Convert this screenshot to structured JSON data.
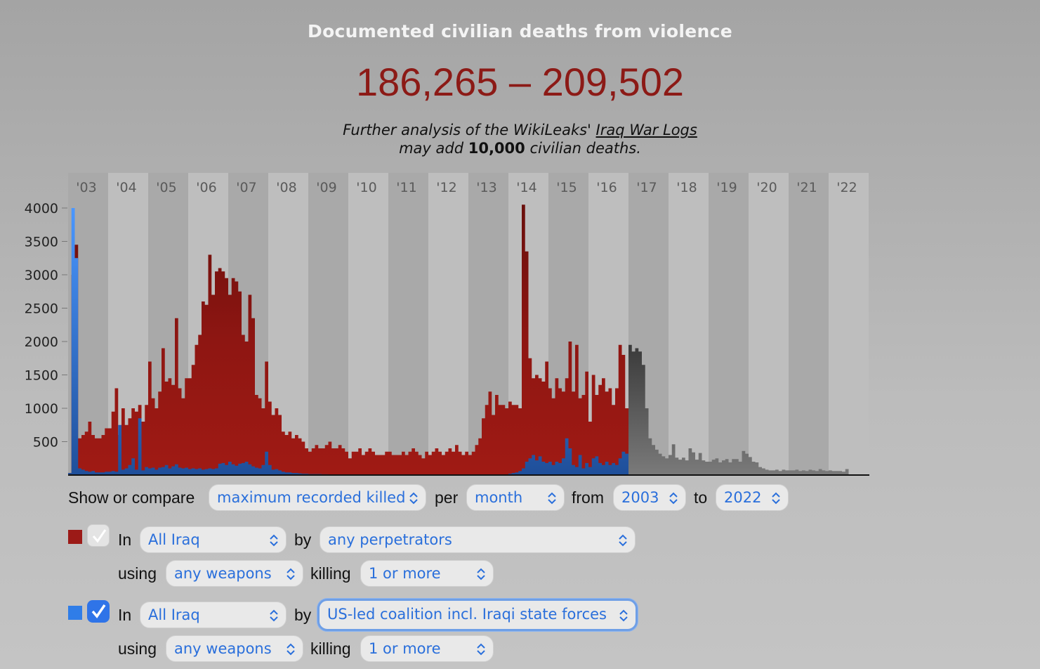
{
  "header": {
    "title": "Documented civilian deaths from violence",
    "range": "186,265 – 209,502",
    "note_line1_prefix": "Further analysis of the WikiLeaks' ",
    "note_link": "Iraq War Logs",
    "note_line2_prefix": "may add ",
    "note_bold": "10,000",
    "note_line2_suffix": " civilian deaths."
  },
  "chart_data": {
    "type": "bar",
    "x_ticks": [
      "'03",
      "'04",
      "'05",
      "'06",
      "'07",
      "'08",
      "'09",
      "'10",
      "'11",
      "'12",
      "'13",
      "'14",
      "'15",
      "'16",
      "'17",
      "'18",
      "'19",
      "'20",
      "'21",
      "'22"
    ],
    "y_ticks": [
      "4000",
      "3500",
      "3000",
      "2500",
      "2000",
      "1500",
      "1000",
      "500"
    ],
    "ylim": [
      0,
      4000
    ],
    "grid": "alternating year bands",
    "series": [
      {
        "color": "#8e1612",
        "start": "2003-01",
        "end": "2016-12",
        "monthly_values": [
          30,
          3000,
          3450,
          550,
          600,
          650,
          800,
          600,
          550,
          550,
          600,
          700,
          700,
          950,
          1300,
          600,
          1000,
          750,
          850,
          1000,
          950,
          1050,
          800,
          1050,
          1700,
          1150,
          1000,
          1250,
          1900,
          1400,
          1450,
          1350,
          2350,
          1300,
          1150,
          1450,
          1450,
          1650,
          1950,
          2100,
          2600,
          2550,
          3300,
          2700,
          3050,
          3100,
          3050,
          2950,
          2700,
          2950,
          2900,
          2750,
          2100,
          2000,
          2700,
          2350,
          1200,
          1150,
          1000,
          1700,
          1100,
          900,
          1000,
          900,
          650,
          600,
          650,
          550,
          600,
          550,
          500,
          400,
          350,
          400,
          450,
          400,
          400,
          450,
          500,
          400,
          400,
          450,
          400,
          350,
          250,
          350,
          350,
          400,
          300,
          350,
          400,
          350,
          300,
          300,
          300,
          350,
          350,
          300,
          300,
          300,
          350,
          300,
          350,
          400,
          350,
          300,
          250,
          350,
          300,
          350,
          400,
          350,
          300,
          350,
          400,
          350,
          450,
          350,
          300,
          350,
          300,
          350,
          450,
          550,
          850,
          1050,
          1250,
          900,
          1200,
          1050,
          1050,
          1000,
          1100,
          1050,
          1050,
          1000,
          4050,
          3350,
          1750,
          1450,
          1500,
          1450,
          1400,
          1700,
          1300,
          1150,
          1450,
          1300,
          1250,
          1450,
          2000,
          1250,
          1950,
          1150,
          1200,
          1550,
          800,
          1500,
          1200,
          1350,
          1450,
          1250,
          1300,
          1050,
          1300,
          1950,
          1800,
          1000
        ]
      },
      {
        "color": "#2f7de8",
        "start": "2003-01",
        "end": "2016-12",
        "monthly_values": [
          30,
          4000,
          3250,
          100,
          80,
          60,
          50,
          60,
          40,
          40,
          40,
          50,
          50,
          60,
          50,
          750,
          80,
          100,
          150,
          250,
          80,
          850,
          70,
          120,
          100,
          110,
          80,
          110,
          120,
          150,
          100,
          130,
          160,
          110,
          100,
          110,
          90,
          100,
          90,
          100,
          80,
          90,
          100,
          90,
          100,
          170,
          180,
          150,
          200,
          160,
          140,
          170,
          180,
          200,
          160,
          130,
          110,
          100,
          150,
          350,
          150,
          80,
          90,
          70,
          50,
          40,
          40,
          30,
          30,
          25,
          20,
          20,
          15,
          15,
          15,
          15,
          12,
          12,
          10,
          10,
          10,
          10,
          8,
          8,
          8,
          8,
          6,
          6,
          5,
          5,
          5,
          5,
          5,
          5,
          5,
          5,
          4,
          4,
          4,
          4,
          3,
          3,
          3,
          3,
          3,
          3,
          3,
          3,
          2,
          2,
          2,
          2,
          2,
          2,
          2,
          2,
          2,
          2,
          2,
          2,
          2,
          2,
          2,
          2,
          2,
          2,
          2,
          2,
          2,
          2,
          2,
          2,
          20,
          30,
          40,
          60,
          100,
          200,
          250,
          300,
          220,
          280,
          200,
          180,
          200,
          150,
          200,
          180,
          250,
          550,
          400,
          150,
          120,
          300,
          100,
          180,
          120,
          250,
          280,
          180,
          150,
          200,
          150,
          180,
          150,
          250,
          350,
          320
        ]
      },
      {
        "color": "#5f5f5f",
        "start": "2017-01",
        "end": "2022-06",
        "monthly_values": [
          1950,
          1850,
          1900,
          1850,
          1650,
          1000,
          550,
          450,
          380,
          320,
          280,
          250,
          300,
          460,
          260,
          230,
          260,
          220,
          400,
          340,
          230,
          330,
          220,
          200,
          200,
          230,
          250,
          190,
          220,
          240,
          190,
          240,
          240,
          200,
          360,
          320,
          270,
          200,
          190,
          120,
          100,
          80,
          70,
          70,
          80,
          60,
          80,
          70,
          70,
          70,
          80,
          60,
          70,
          60,
          80,
          70,
          60,
          90,
          70,
          60,
          70,
          60,
          60,
          60,
          50,
          90
        ]
      }
    ]
  },
  "controls": {
    "row1": {
      "show_label": "Show or compare",
      "measure": "maximum recorded killed",
      "per_label": "per",
      "period": "month",
      "from_label": "from",
      "from_year": "2003",
      "to_label": "to",
      "to_year": "2022"
    },
    "filters": [
      {
        "color": "#9c1a17",
        "in_label": "In",
        "region": "All Iraq",
        "by_label": "by",
        "perpetrator": "any perpetrators",
        "using_label": "using",
        "weapon": "any weapons",
        "killing_label": "killing",
        "min_killed": "1 or more"
      },
      {
        "color": "#2f7de8",
        "in_label": "In",
        "region": "All Iraq",
        "by_label": "by",
        "perpetrator": "US-led coalition incl. Iraqi state forces",
        "using_label": "using",
        "weapon": "any weapons",
        "killing_label": "killing",
        "min_killed": "1 or more"
      }
    ]
  }
}
